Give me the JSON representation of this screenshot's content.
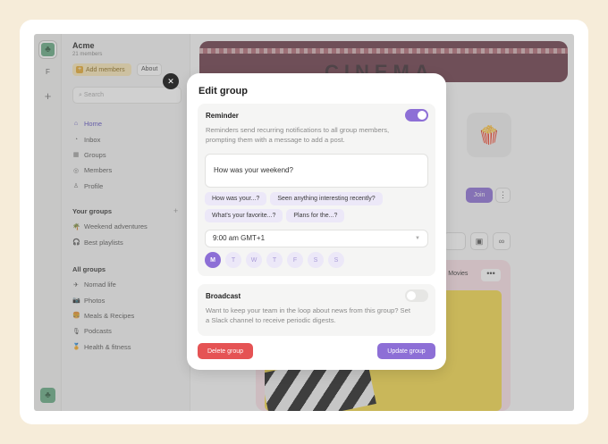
{
  "org": {
    "name": "Acme",
    "members": "21 members",
    "add_members": "Add members",
    "about": "About",
    "initial": "F"
  },
  "search": {
    "placeholder": "Search"
  },
  "nav": [
    {
      "label": "Home",
      "icon": "home-icon"
    },
    {
      "label": "Inbox",
      "icon": "bell-icon"
    },
    {
      "label": "Groups",
      "icon": "groups-icon"
    },
    {
      "label": "Members",
      "icon": "members-icon"
    },
    {
      "label": "Profile",
      "icon": "user-icon"
    }
  ],
  "your_groups": {
    "title": "Your groups",
    "items": [
      {
        "label": "Weekend adventures",
        "icon": "palm-tree-icon"
      },
      {
        "label": "Best playlists",
        "icon": "headphones-icon"
      }
    ]
  },
  "all_groups": {
    "title": "All groups",
    "items": [
      {
        "label": "Nomad life",
        "icon": "plane-icon"
      },
      {
        "label": "Photos",
        "icon": "camera-icon"
      },
      {
        "label": "Meals & Recipes",
        "icon": "food-icon"
      },
      {
        "label": "Podcasts",
        "icon": "podcast-icon"
      },
      {
        "label": "Health & fitness",
        "icon": "fitness-icon"
      }
    ]
  },
  "main": {
    "banner_text": "CINEMA",
    "join": "Join",
    "card_tag": "Movies"
  },
  "modal": {
    "title": "Edit group",
    "reminder": {
      "title": "Reminder",
      "enabled": true,
      "description": "Reminders send recurring notifications to all group members, prompting them with a message to add a post.",
      "message": "How was your weekend?",
      "suggestions": [
        "How was your...?",
        "Seen anything interesting recently?",
        "What's your favorite...?",
        "Plans for the...?"
      ],
      "time": "9:00 am GMT+1",
      "days": [
        {
          "label": "M",
          "active": true
        },
        {
          "label": "T",
          "active": false
        },
        {
          "label": "W",
          "active": false
        },
        {
          "label": "T",
          "active": false
        },
        {
          "label": "F",
          "active": false
        },
        {
          "label": "S",
          "active": false
        },
        {
          "label": "S",
          "active": false
        }
      ]
    },
    "broadcast": {
      "title": "Broadcast",
      "enabled": false,
      "description": "Want to keep your team in the loop about news from this group? Set a Slack channel to receive periodic digests."
    },
    "delete_label": "Delete group",
    "update_label": "Update group"
  },
  "colors": {
    "accent": "#8d6fd6",
    "danger": "#e55354",
    "background": "#f6ecd9"
  }
}
